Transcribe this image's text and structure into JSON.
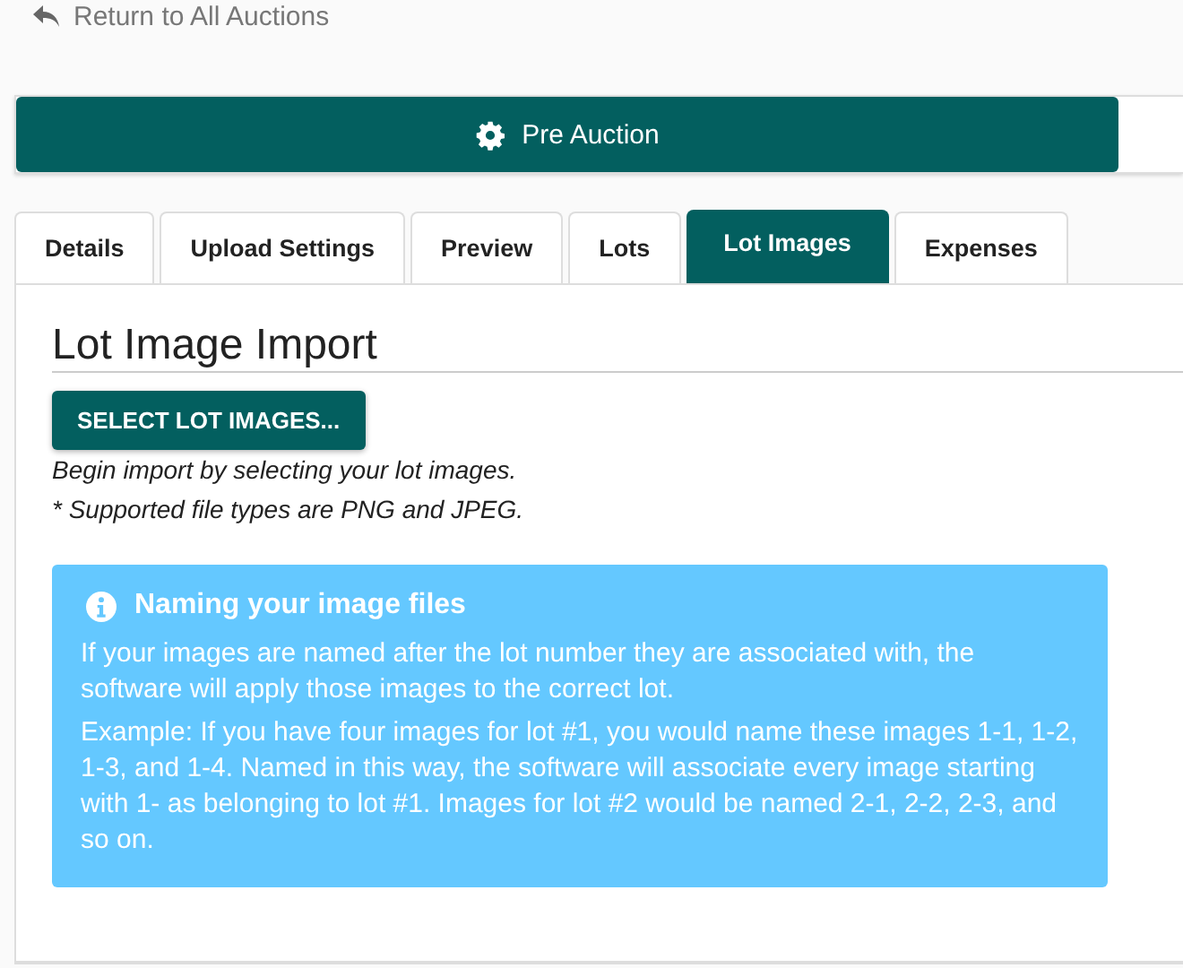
{
  "back_link": {
    "label": "Return to All Auctions"
  },
  "stage_bar": {
    "label": "Pre Auction"
  },
  "tabs": [
    {
      "label": "Details",
      "selected": false
    },
    {
      "label": "Upload Settings",
      "selected": false
    },
    {
      "label": "Preview",
      "selected": false
    },
    {
      "label": "Lots",
      "selected": false
    },
    {
      "label": "Lot Images",
      "selected": true
    },
    {
      "label": "Expenses",
      "selected": false
    }
  ],
  "panel": {
    "heading": "Lot Image Import",
    "button": "SELECT LOT IMAGES...",
    "notes": [
      "Begin import by selecting your lot images.",
      "* Supported file types are PNG and JPEG."
    ]
  },
  "info_box": {
    "title": "Naming your image files",
    "paragraphs": [
      "If your images are named after the lot number they are associated with, the software will apply those images to the correct lot.",
      "Example: If you have four images for lot #1, you would name these images 1-1, 1-2, 1-3, and 1-4. Named in this way, the software will associate every image starting with 1- as belonging to lot #1. Images for lot #2 would be named 2-1, 2-2, 2-3, and so on."
    ]
  }
}
